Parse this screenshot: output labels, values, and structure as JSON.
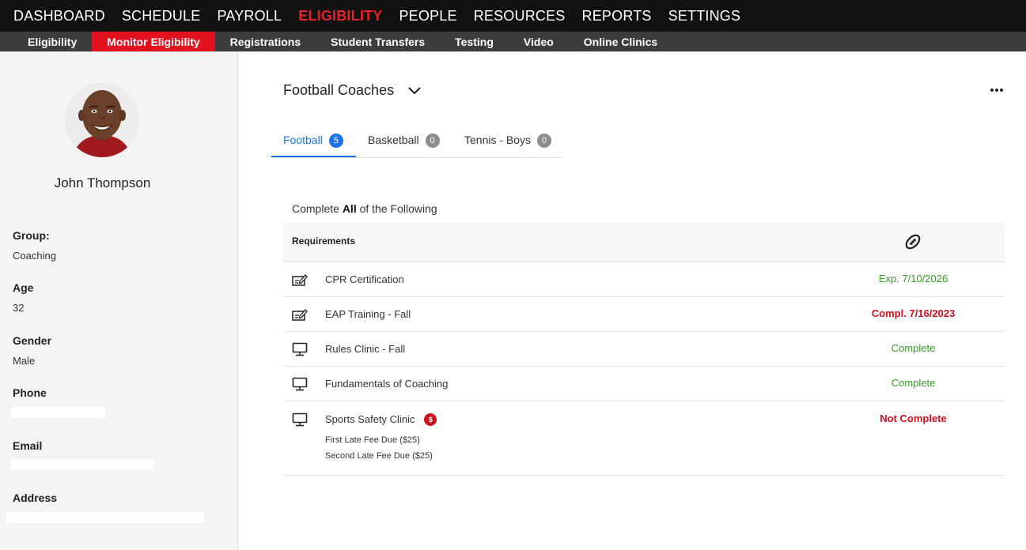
{
  "topnav": {
    "items": [
      "DASHBOARD",
      "SCHEDULE",
      "PAYROLL",
      "ELIGIBILITY",
      "PEOPLE",
      "RESOURCES",
      "REPORTS",
      "SETTINGS"
    ],
    "active_index": 3,
    "active_color": "#e4202d"
  },
  "subnav": {
    "items": [
      "Eligibility",
      "Monitor Eligibility",
      "Registrations",
      "Student Transfers",
      "Testing",
      "Video",
      "Online Clinics"
    ],
    "active_index": 1,
    "active_color": "#e4121f"
  },
  "profile": {
    "name": "John Thompson",
    "group_label": "Group:",
    "group": "Coaching",
    "age_label": "Age",
    "age": "32",
    "gender_label": "Gender",
    "gender": "Male",
    "phone_label": "Phone",
    "email_label": "Email",
    "address_label": "Address"
  },
  "main": {
    "group_title": "Football Coaches",
    "tabs": [
      {
        "label": "Football",
        "count": "5"
      },
      {
        "label": "Basketball",
        "count": "0"
      },
      {
        "label": "Tennis - Boys",
        "count": "0"
      }
    ],
    "active_tab": 0,
    "complete_prefix": "Complete",
    "complete_strong": "All",
    "complete_suffix": "of the Following",
    "requirements_header": "Requirements",
    "requirements": [
      {
        "icon": "certificate-edit-icon",
        "name": "CPR Certification",
        "status": "Exp. 7/10/2026",
        "status_type": "green"
      },
      {
        "icon": "certificate-edit-icon",
        "name": "EAP Training - Fall",
        "status": "Compl. 7/16/2023",
        "status_type": "red"
      },
      {
        "icon": "monitor-icon",
        "name": "Rules Clinic - Fall",
        "status": "Complete",
        "status_type": "green"
      },
      {
        "icon": "monitor-icon",
        "name": "Fundamentals of Coaching",
        "status": "Complete",
        "status_type": "green"
      },
      {
        "icon": "monitor-icon",
        "name": "Sports Safety Clinic",
        "status": "Not Complete",
        "status_type": "red",
        "fee_badge": "$",
        "notes": [
          "First Late Fee Due ($25)",
          "Second Late Fee Due ($25)"
        ]
      }
    ]
  },
  "colors": {
    "accent_blue": "#1a73e8",
    "status_green": "#3a9a2a",
    "status_red": "#d0101c"
  }
}
